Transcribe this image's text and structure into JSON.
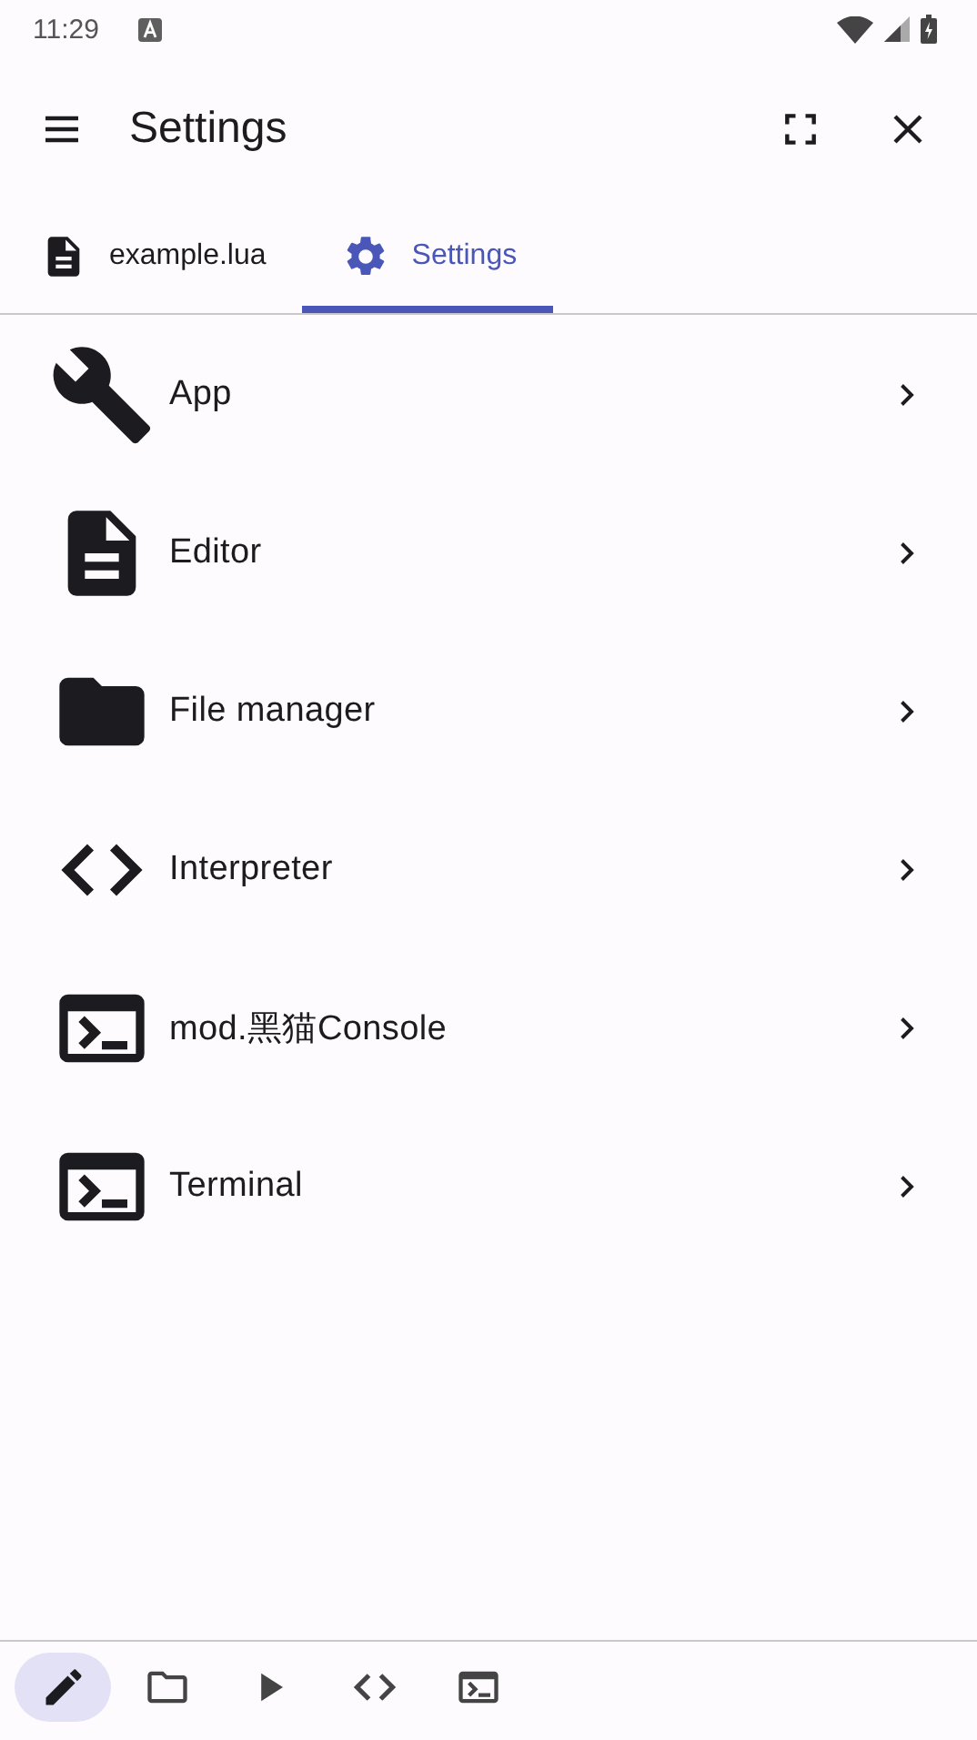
{
  "status_bar": {
    "time": "11:29"
  },
  "app_bar": {
    "title": "Settings"
  },
  "tabs": [
    {
      "label": "example.lua",
      "kind": "document",
      "selected": false
    },
    {
      "label": "Settings",
      "kind": "gear",
      "selected": true
    }
  ],
  "settings": [
    {
      "label": "App",
      "kind": "wrench"
    },
    {
      "label": "Editor",
      "kind": "document"
    },
    {
      "label": "File manager",
      "kind": "folder"
    },
    {
      "label": "Interpreter",
      "kind": "code"
    },
    {
      "label": "mod.黑猫Console",
      "kind": "terminal"
    },
    {
      "label": "Terminal",
      "kind": "terminal"
    }
  ],
  "bottom_nav": [
    {
      "kind": "pencil",
      "selected": true
    },
    {
      "kind": "folder",
      "selected": false
    },
    {
      "kind": "play",
      "selected": false
    },
    {
      "kind": "code",
      "selected": false
    },
    {
      "kind": "terminal",
      "selected": false
    }
  ]
}
